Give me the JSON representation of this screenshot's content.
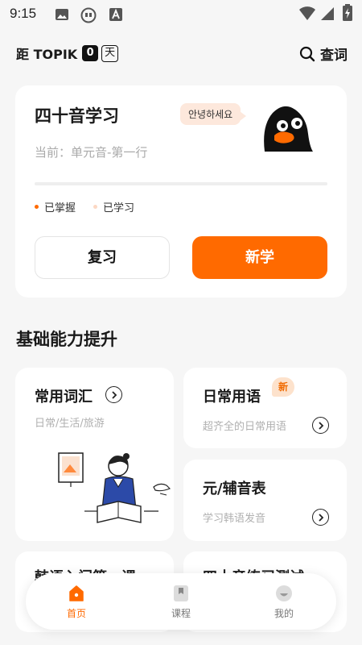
{
  "status_bar": {
    "time": "9:15"
  },
  "header": {
    "countdown_prefix": "距 TOPIK",
    "countdown_days": "0",
    "countdown_unit": "天",
    "dict_label": "查词"
  },
  "study_card": {
    "title": "四十音学习",
    "current": "当前：单元音-第一行",
    "bubble_text": "안녕하세요",
    "progress": 0,
    "legend_mastered": "已掌握",
    "legend_learned": "已学习",
    "review_label": "复习",
    "new_label": "新学"
  },
  "section": {
    "title": "基础能力提升"
  },
  "cards": {
    "vocab": {
      "title": "常用词汇",
      "subtitle": "日常/生活/旅游"
    },
    "phrases": {
      "title": "日常用语",
      "subtitle": "超齐全的日常用语",
      "badge": "新"
    },
    "vowels": {
      "title": "元/辅音表",
      "subtitle": "学习韩语发音"
    },
    "peek_left": {
      "title": "韩语入门第一课"
    },
    "peek_right": {
      "title": "四十音练习测试"
    }
  },
  "tabbar": {
    "home": "首页",
    "course": "课程",
    "mine": "我的"
  },
  "colors": {
    "accent": "#ff6a00",
    "background": "#f6f6f6",
    "bubble": "#fde8dc"
  }
}
